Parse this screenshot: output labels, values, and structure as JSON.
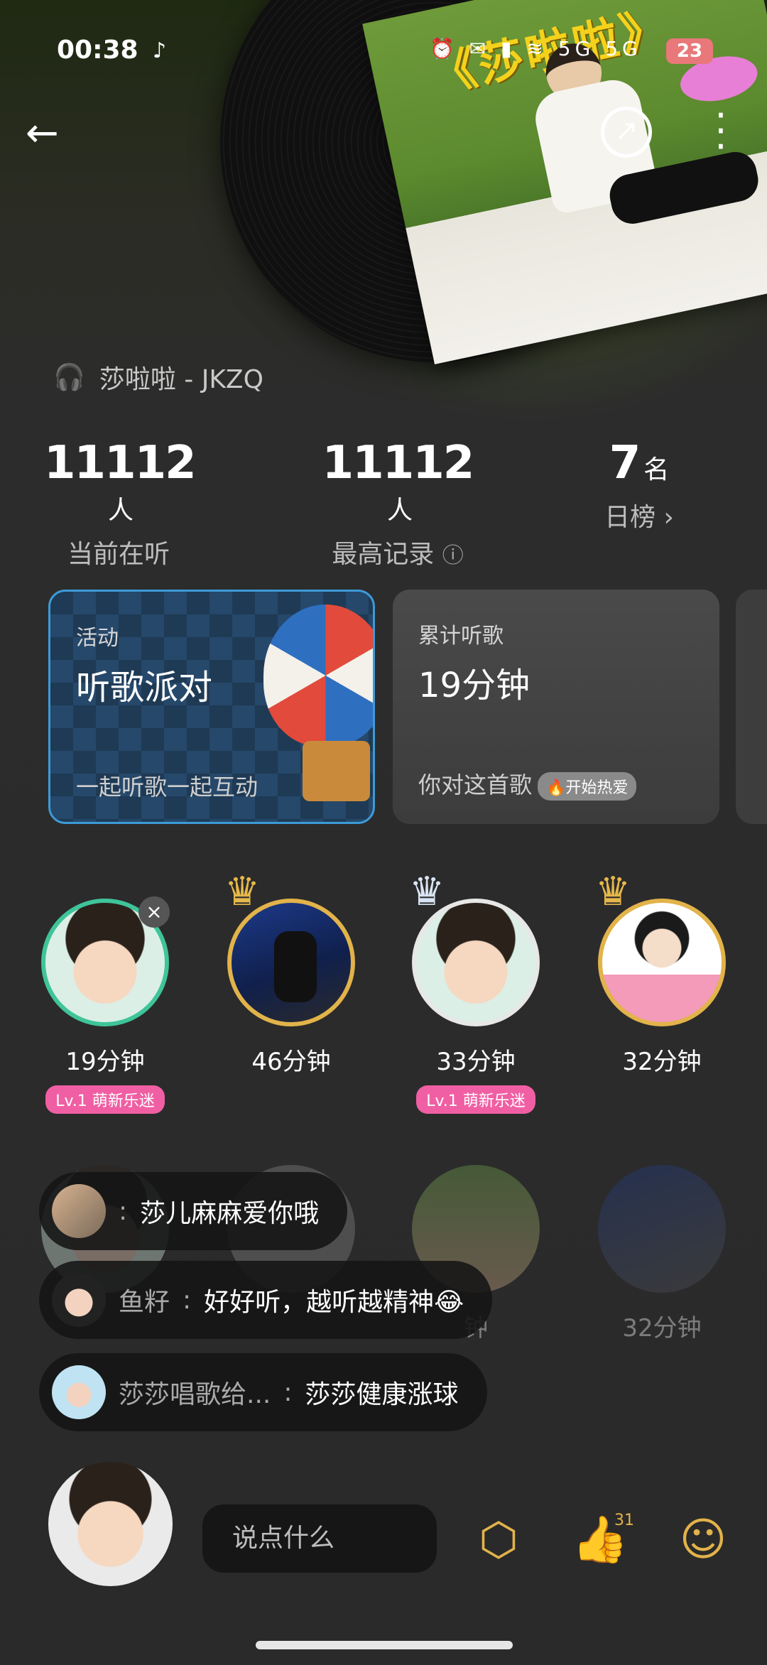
{
  "status_bar": {
    "time": "00:38",
    "app_icon": "tiktok-icon",
    "signal_text": "5G 5G",
    "battery": "23"
  },
  "cover": {
    "title": "《莎啦啦》"
  },
  "song": {
    "icon": "headphones-icon",
    "title": "莎啦啦 - JKZQ"
  },
  "stats": [
    {
      "value": "11112",
      "unit": "人",
      "label": "当前在听"
    },
    {
      "value": "11112",
      "unit": "人",
      "label": "最高记录"
    },
    {
      "value": "7",
      "unit": "名",
      "label": "日榜"
    }
  ],
  "cards": {
    "activity": {
      "tag": "活动",
      "title": "听歌派对",
      "subtitle": "一起听歌一起互动"
    },
    "listen": {
      "tag": "累计听歌",
      "title": "19分钟",
      "subtitle": "你对这首歌",
      "badge": "开始热爱"
    }
  },
  "listeners": [
    {
      "duration": "19分钟",
      "level": "Lv.1 萌新乐迷"
    },
    {
      "duration": "46分钟",
      "level": ""
    },
    {
      "duration": "33分钟",
      "level": "Lv.1 萌新乐迷"
    },
    {
      "duration": "32分钟",
      "level": ""
    }
  ],
  "listeners_row2": [
    {
      "duration": ""
    },
    {
      "duration": ""
    },
    {
      "duration": "钟"
    },
    {
      "duration": "32分钟"
    }
  ],
  "comments": [
    {
      "name": "",
      "message": "莎儿麻麻爱你哦"
    },
    {
      "name": "鱼籽",
      "message": "好好听，越听越精神😂"
    },
    {
      "name": "莎莎唱歌给...",
      "message": "莎莎健康涨球"
    }
  ],
  "composer": {
    "placeholder": "说点什么",
    "like_count": "31"
  },
  "colors": {
    "accent_gold": "#e2b34a",
    "level_pink": "#f05fa3",
    "activity_border": "#3d9ad8"
  }
}
